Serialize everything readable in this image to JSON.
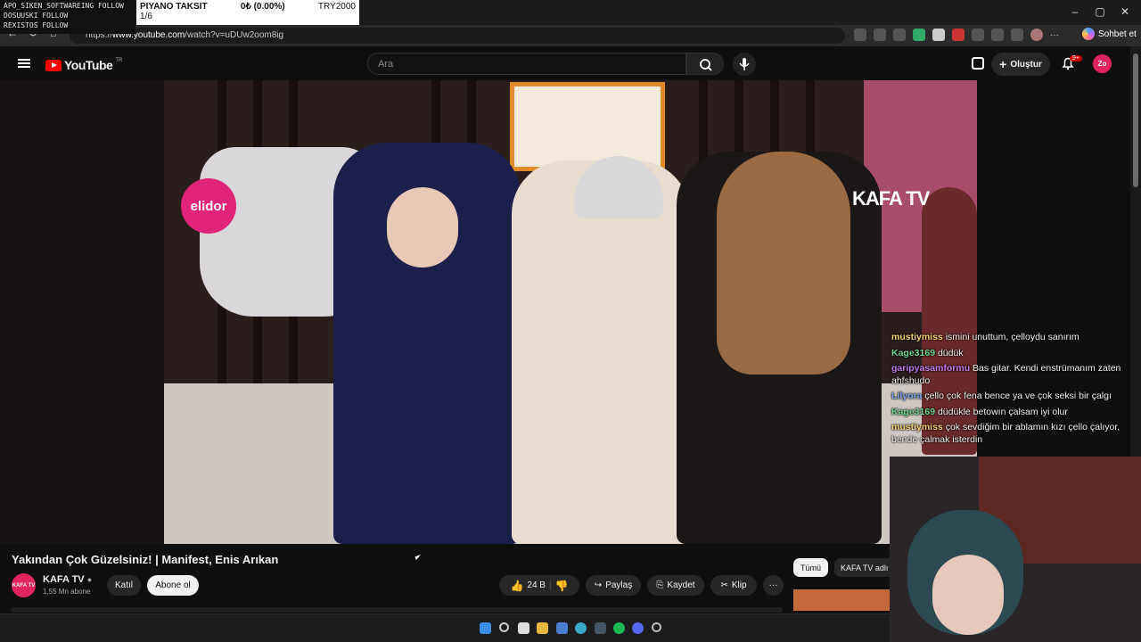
{
  "overlay": {
    "streamer_lines": [
      "APO_SIKEN_SOFTWAREING FOLLOW",
      "DOSUUSKI FOLLOW",
      "REXISTOS FOLLOW"
    ],
    "ticker": {
      "name": "PIYANO TAKSIT",
      "change": "0₺ (0.00%)",
      "price": "TRY2000",
      "page": "1/6"
    }
  },
  "browser": {
    "url_prefix": "https://",
    "url_host": "www.youtube.com",
    "url_path": "/watch?v=uDUw2oom8ig",
    "chat_button": "Sohbet et",
    "ext_dots": "···"
  },
  "youtube": {
    "logo_text": "YouTube",
    "logo_region": "TR",
    "search_placeholder": "Ara",
    "create_label": "Oluştur",
    "notif_badge": "9+",
    "avatar_initials": "Zo"
  },
  "video": {
    "sponsor": "elidor",
    "watermark": "KAFA TV",
    "title": "Yakından Çok Güzelsiniz! | Manifest, Enis Arıkan",
    "channel": "KAFA TV",
    "subscribers": "1,55 Mn abone",
    "join_label": "Katıl",
    "subscribe_label": "Abone ol",
    "likes": "24 B",
    "share_label": "Paylaş",
    "save_label": "Kaydet",
    "clip_label": "Klip",
    "chip_all": "Tümü",
    "chip_channel": "KAFA TV adlı"
  },
  "chat": [
    {
      "user": "mustiymiss",
      "text": "ismini unuttum, çelloydu sanırım",
      "color": "#f5cd72"
    },
    {
      "user": "Kage3169",
      "text": "düdük",
      "color": "#6fd58a"
    },
    {
      "user": "garipyasamformu",
      "text": "Bas gitar. Kendi enstrümanım zaten ahfshudo",
      "color": "#c47af0"
    },
    {
      "user": "Lilyora",
      "text": "çello çok fena bence ya ve çok seksi bir çalgı",
      "color": "#7aa8f0"
    },
    {
      "user": "Kage3169",
      "text": "düdükle betowın çalsam iyi olur",
      "color": "#6fd58a"
    },
    {
      "user": "mustiymiss",
      "text": "çok sevdiğim bir ablamın kızı çello çalıyor, bende çalmak isterdin",
      "color": "#f5cd72"
    }
  ],
  "icons": [
    "back-icon",
    "refresh-icon",
    "home-icon",
    "menu-icon",
    "search-icon",
    "mic-icon",
    "create-icon",
    "bell-icon",
    "like-icon",
    "dislike-icon",
    "share-icon",
    "save-icon",
    "clip-icon",
    "more-icon",
    "verified-icon"
  ]
}
